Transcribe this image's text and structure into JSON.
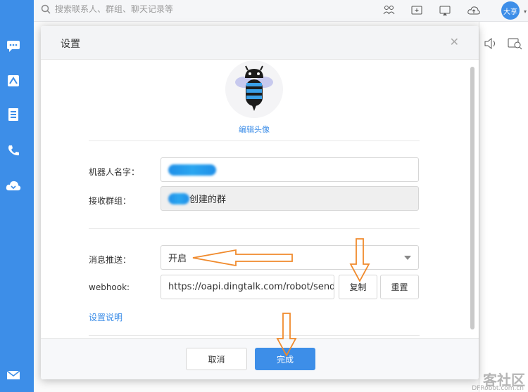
{
  "search": {
    "placeholder": "搜索联系人、群组、聊天记录等"
  },
  "user": {
    "avatar_label": "大享"
  },
  "watermark": {
    "text": "客社区",
    "sub": "DFRobot.com.cn"
  },
  "dialog": {
    "title": "设置",
    "edit_avatar": "编辑头像",
    "name_label": "机器人名字：",
    "group_label": "接收群组：",
    "group_value_suffix": "创建的群",
    "push_label": "消息推送：",
    "push_value": "开启",
    "webhook_label": "webhook:",
    "webhook_value": "https://oapi.dingtalk.com/robot/send",
    "copy_button": "复制",
    "reset_button": "重置",
    "help_link": "设置说明",
    "cancel_button": "取消",
    "done_button": "完成"
  },
  "colors": {
    "accent": "#3d8ee8",
    "annotation_arrow": "#f08a2c"
  },
  "icons": {
    "leftbar": [
      "chat-icon",
      "work-icon",
      "contacts-icon",
      "phone-icon",
      "cloud-icon",
      "mail-icon"
    ],
    "topbar": [
      "add-contact-icon",
      "new-message-icon",
      "screen-share-icon",
      "cloud-upload-icon"
    ]
  }
}
